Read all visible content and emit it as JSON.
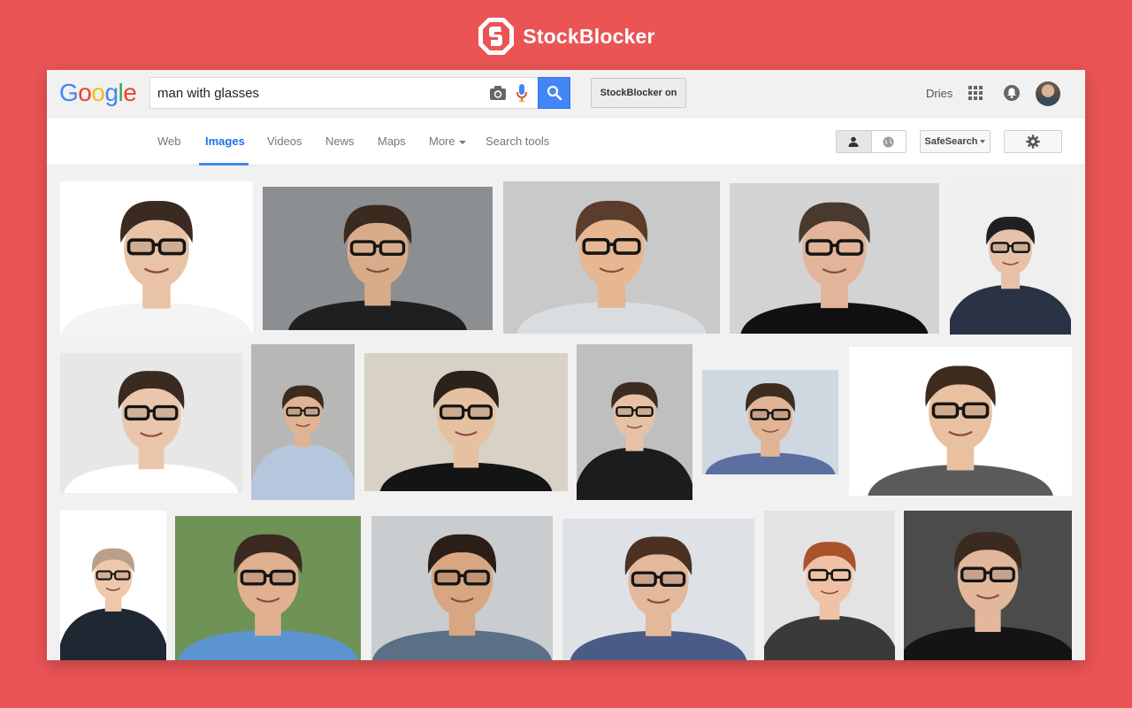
{
  "brand": {
    "name": "StockBlocker",
    "color": "#ea5455"
  },
  "google": {
    "logo_letters": [
      {
        "ch": "G",
        "color": "#4285f4"
      },
      {
        "ch": "o",
        "color": "#ea4335"
      },
      {
        "ch": "o",
        "color": "#fbbc05"
      },
      {
        "ch": "g",
        "color": "#4285f4"
      },
      {
        "ch": "l",
        "color": "#34a853"
      },
      {
        "ch": "e",
        "color": "#ea4335"
      }
    ]
  },
  "search": {
    "query": "man with glasses",
    "camera_icon": "camera-icon",
    "mic_icon": "microphone-icon",
    "button_icon": "search-icon"
  },
  "extension_toggle": {
    "label": "StockBlocker on"
  },
  "account": {
    "user_name": "Dries",
    "apps_icon": "apps-grid-icon",
    "notifications_icon": "bell-icon"
  },
  "nav": {
    "tabs": [
      {
        "label": "Web"
      },
      {
        "label": "Images",
        "active": true
      },
      {
        "label": "Videos"
      },
      {
        "label": "News"
      },
      {
        "label": "Maps"
      },
      {
        "label": "More"
      },
      {
        "label": "Search tools"
      }
    ],
    "safesearch_label": "SafeSearch",
    "settings_icon": "gear-icon"
  },
  "results": {
    "thumbnail_count": 17
  }
}
